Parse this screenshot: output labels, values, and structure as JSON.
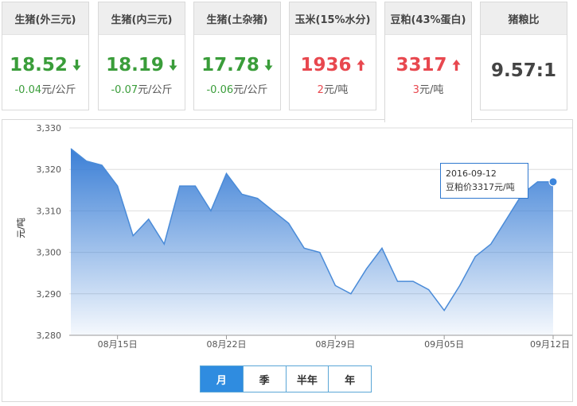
{
  "cards": [
    {
      "label": "生猪(外三元)",
      "price": "18.52",
      "change_num": "-0.04",
      "change_unit": "元/公斤",
      "direction": "down"
    },
    {
      "label": "生猪(内三元)",
      "price": "18.19",
      "change_num": "-0.07",
      "change_unit": "元/公斤",
      "direction": "down"
    },
    {
      "label": "生猪(土杂猪)",
      "price": "17.78",
      "change_num": "-0.06",
      "change_unit": "元/公斤",
      "direction": "down"
    },
    {
      "label": "玉米(15%水分)",
      "price": "1936",
      "change_num": "2",
      "change_unit": "元/吨",
      "direction": "up"
    },
    {
      "label": "豆粕(43%蛋白)",
      "price": "3317",
      "change_num": "3",
      "change_unit": "元/吨",
      "direction": "up"
    },
    {
      "label": "猪粮比",
      "price": "9.57:1",
      "direction": "flat"
    }
  ],
  "tabs": [
    {
      "label": "月",
      "selected": true
    },
    {
      "label": "季",
      "selected": false
    },
    {
      "label": "半年",
      "selected": false
    },
    {
      "label": "年",
      "selected": false
    }
  ],
  "tooltip": {
    "date": "2016-09-12",
    "text": "豆粕价3317元/吨"
  },
  "colors": {
    "down": "#3a9d3a",
    "up": "#e8484f",
    "line": "#4a8bd8",
    "tab_selected": "#2f8ce0"
  },
  "chart_data": {
    "type": "area",
    "ylabel": "元/吨",
    "ylim": [
      3280,
      3330
    ],
    "yticks": [
      3280,
      3290,
      3300,
      3310,
      3320,
      3330
    ],
    "ytick_labels": [
      "3,280",
      "3,290",
      "3,300",
      "3,310",
      "3,320",
      "3,330"
    ],
    "xticks": [
      "08月15日",
      "08月22日",
      "08月29日",
      "09月05日",
      "09月12日"
    ],
    "x": [
      "08-12",
      "08-13",
      "08-14",
      "08-15",
      "08-16",
      "08-17",
      "08-18",
      "08-19",
      "08-20",
      "08-21",
      "08-22",
      "08-23",
      "08-24",
      "08-25",
      "08-26",
      "08-27",
      "08-28",
      "08-29",
      "08-30",
      "08-31",
      "09-01",
      "09-02",
      "09-03",
      "09-04",
      "09-05",
      "09-06",
      "09-07",
      "09-08",
      "09-09",
      "09-10",
      "09-11",
      "09-12"
    ],
    "series": [
      {
        "values": [
          3325,
          3322,
          3321,
          3316,
          3304,
          3308,
          3302,
          3316,
          3316,
          3310,
          3319,
          3314,
          3313,
          3310,
          3307,
          3301,
          3300,
          3292,
          3290,
          3296,
          3301,
          3293,
          3293,
          3291,
          3286,
          3292,
          3299,
          3302,
          3308,
          3314,
          3317,
          3317
        ]
      }
    ],
    "highlight_index": 31,
    "grid": true,
    "legend": "none"
  }
}
